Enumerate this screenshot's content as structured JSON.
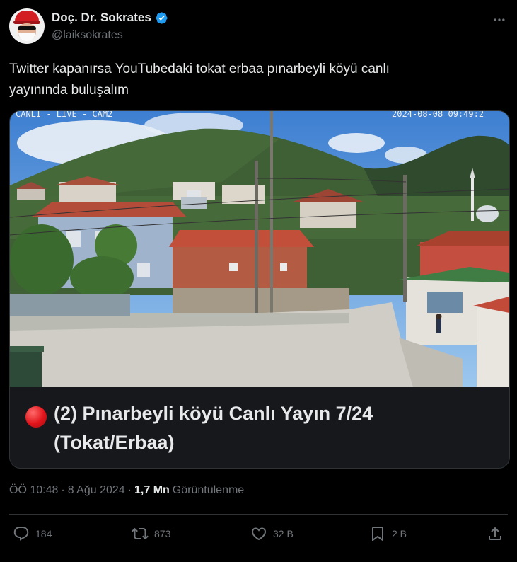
{
  "author": {
    "display_name": "Doç. Dr. Sokrates",
    "handle": "@laiksokrates",
    "verified": true
  },
  "tweet": {
    "text_line1": "Twitter kapanırsa YouTubedaki tokat erbaa pınarbeyli köyü canlı",
    "text_line2": "yayınında buluşalım"
  },
  "card": {
    "overlay_left": "CANLI - LIVE - CAM2",
    "overlay_right": "2024-08-08 09:49:2",
    "title_line1": "(2) Pınarbeyli köyü Canlı Yayın 7/24",
    "title_line2": "(Tokat/Erbaa)"
  },
  "meta": {
    "time": "ÖÖ 10:48",
    "date": "8 Ağu 2024",
    "views_count": "1,7 Mn",
    "views_label": "Görüntülenme"
  },
  "actions": {
    "replies": "184",
    "reposts": "873",
    "likes": "32 B",
    "bookmarks": "2 B"
  },
  "colors": {
    "background": "#000000",
    "text_primary": "#e7e9ea",
    "text_secondary": "#71767b",
    "border": "#2f3336",
    "verified_blue": "#1d9bf0",
    "live_red": "#e0141a"
  },
  "icons": [
    "verified-badge-icon",
    "more-dots-icon",
    "live-dot-icon",
    "reply-icon",
    "repost-icon",
    "like-icon",
    "bookmark-icon",
    "share-icon"
  ]
}
